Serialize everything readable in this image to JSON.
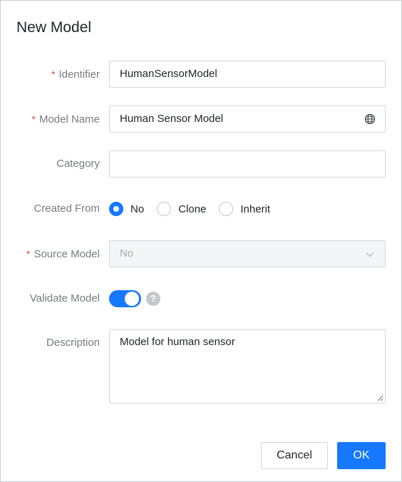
{
  "dialog": {
    "title": "New Model"
  },
  "form": {
    "identifier": {
      "label": "Identifier",
      "required_mark": "*",
      "value": "HumanSensorModel"
    },
    "model_name": {
      "label": "Model Name",
      "required_mark": "*",
      "value": "Human Sensor Model",
      "icon": "globe-icon"
    },
    "category": {
      "label": "Category",
      "value": ""
    },
    "created_from": {
      "label": "Created From",
      "options": [
        "No",
        "Clone",
        "Inherit"
      ],
      "selected": "No"
    },
    "source_model": {
      "label": "Source Model",
      "required_mark": "*",
      "value": "No",
      "disabled": true,
      "icon": "chevron-down-icon"
    },
    "validate_model": {
      "label": "Validate Model",
      "enabled": true,
      "help_icon": "?"
    },
    "description": {
      "label": "Description",
      "value": "Model for human sensor"
    }
  },
  "footer": {
    "cancel_label": "Cancel",
    "ok_label": "OK"
  },
  "colors": {
    "accent": "#1677ff",
    "required": "#e0434f",
    "label": "#767b83"
  }
}
